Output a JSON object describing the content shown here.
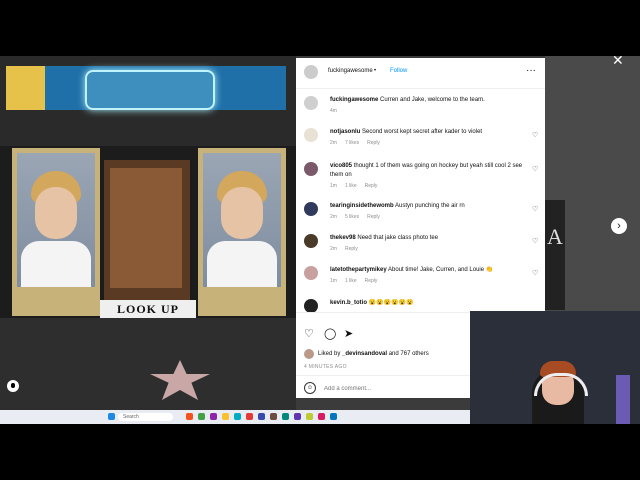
{
  "post": {
    "mat_text": "LOOK UP",
    "author": "fuckingawesome",
    "separator": "•",
    "follow_label": "Follow",
    "more_label": "···",
    "close_label": "✕",
    "next_label": "›"
  },
  "comments": [
    {
      "user": "fuckingawesome",
      "text": "Curren and Jake, welcome to the team.",
      "time": "4m",
      "likes": "",
      "reply": "",
      "avatar_color": "#cfcfcf"
    },
    {
      "user": "notjasonlu",
      "text": "Second worst kept secret after kader to violet",
      "time": "2m",
      "likes": "7 likes",
      "reply": "Reply",
      "avatar_color": "#e9e2d4"
    },
    {
      "user": "vico805",
      "text": "thought 1 of them was going on hockey but yeah still cool 2 see them on",
      "time": "1m",
      "likes": "1 like",
      "reply": "Reply",
      "avatar_color": "#7a5a6a"
    },
    {
      "user": "tearinginsidethewomb",
      "text": "Austyn punching the air rn",
      "time": "2m",
      "likes": "5 likes",
      "reply": "Reply",
      "avatar_color": "#303a5c"
    },
    {
      "user": "thekev98",
      "text": "Need that jake class photo tee",
      "time": "2m",
      "likes": "",
      "reply": "Reply",
      "avatar_color": "#4a3a2a"
    },
    {
      "user": "latetothepartymikey",
      "text": "About time! Jake, Curren, and Louie 👏",
      "time": "1m",
      "likes": "1 like",
      "reply": "Reply",
      "avatar_color": "#c9a0a0"
    },
    {
      "user": "kevin.b_totio",
      "text": "😮😮😮😮😮😮",
      "time": "",
      "likes": "",
      "reply": "",
      "avatar_color": "#222222"
    }
  ],
  "actions": {
    "like_icon": "heart-icon",
    "comment_icon": "comment-icon",
    "share_icon": "share-icon",
    "liked_prefix": "Liked by ",
    "liked_user": "_devinsandoval",
    "liked_suffix": " and 767 others",
    "ago": "4 MINUTES AGO",
    "add_placeholder": "Add a comment..."
  },
  "taskbar": {
    "search_label": "Search",
    "app_colors": [
      "#1e88e5",
      "#f4511e",
      "#43a047",
      "#8e24aa",
      "#fbc02d",
      "#00acc1",
      "#e53935",
      "#3949ab",
      "#6d4c41",
      "#00897b",
      "#5e35b1",
      "#c0ca33",
      "#d81b60",
      "#0277bd"
    ]
  },
  "background": {
    "letters": "A"
  }
}
